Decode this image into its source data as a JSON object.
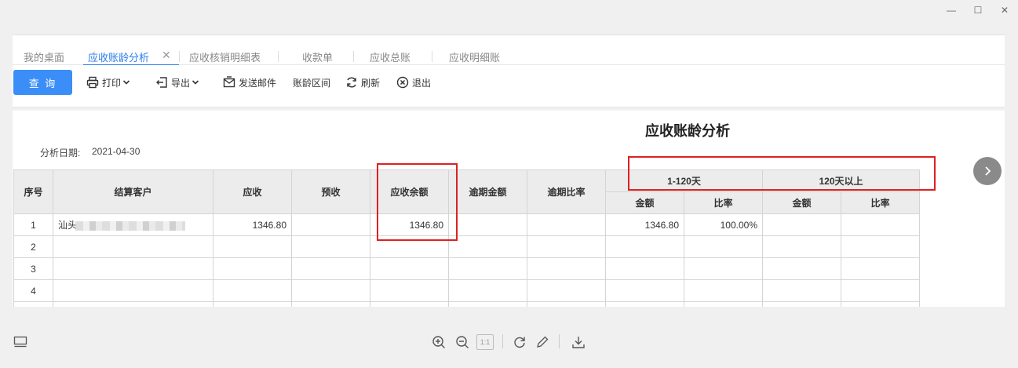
{
  "window": {
    "minimize": "—",
    "maximize": "☐",
    "close": "✕"
  },
  "tabs": [
    {
      "label": "我的桌面"
    },
    {
      "label": "应收账龄分析"
    },
    {
      "label": "应收核销明细表"
    },
    {
      "label": "收款单"
    },
    {
      "label": "应收总账"
    },
    {
      "label": "应收明细账"
    }
  ],
  "tab_close": "✕",
  "toolbar": {
    "query": "查 询",
    "print": "打印",
    "export": "导出",
    "send_mail": "发送邮件",
    "aging_range": "账龄区间",
    "refresh": "刷新",
    "exit": "退出"
  },
  "report": {
    "title": "应收账龄分析",
    "date_label": "分析日期:",
    "date_value": "2021-04-30"
  },
  "table": {
    "headers": {
      "seq": "序号",
      "customer": "结算客户",
      "receivable": "应收",
      "prepaid": "预收",
      "balance": "应收余额",
      "overdue_amount": "逾期金额",
      "overdue_ratio": "逾期比率",
      "group1": "1-120天",
      "group2": "120天以上",
      "amount": "金额",
      "ratio": "比率"
    },
    "rows": [
      {
        "seq": "1",
        "customer": "汕头",
        "receivable": "1346.80",
        "prepaid": "",
        "balance": "1346.80",
        "overdue_amount": "",
        "overdue_ratio": "",
        "g1_amount": "1346.80",
        "g1_ratio": "100.00%",
        "g2_amount": "",
        "g2_ratio": ""
      },
      {
        "seq": "2",
        "customer": "",
        "receivable": "",
        "prepaid": "",
        "balance": "",
        "overdue_amount": "",
        "overdue_ratio": "",
        "g1_amount": "",
        "g1_ratio": "",
        "g2_amount": "",
        "g2_ratio": ""
      },
      {
        "seq": "3",
        "customer": "",
        "receivable": "",
        "prepaid": "",
        "balance": "",
        "overdue_amount": "",
        "overdue_ratio": "",
        "g1_amount": "",
        "g1_ratio": "",
        "g2_amount": "",
        "g2_ratio": ""
      },
      {
        "seq": "4",
        "customer": "",
        "receivable": "",
        "prepaid": "",
        "balance": "",
        "overdue_amount": "",
        "overdue_ratio": "",
        "g1_amount": "",
        "g1_ratio": "",
        "g2_amount": "",
        "g2_ratio": ""
      },
      {
        "seq": "",
        "customer": "",
        "receivable": "",
        "prepaid": "",
        "balance": "",
        "overdue_amount": "",
        "overdue_ratio": "",
        "g1_amount": "",
        "g1_ratio": "",
        "g2_amount": "",
        "g2_ratio": ""
      }
    ]
  },
  "bottom": {
    "page_fit": "1:1"
  },
  "colors": {
    "accent": "#2b7de9",
    "query_button": "#3b8ef7",
    "highlight": "#e02020"
  }
}
